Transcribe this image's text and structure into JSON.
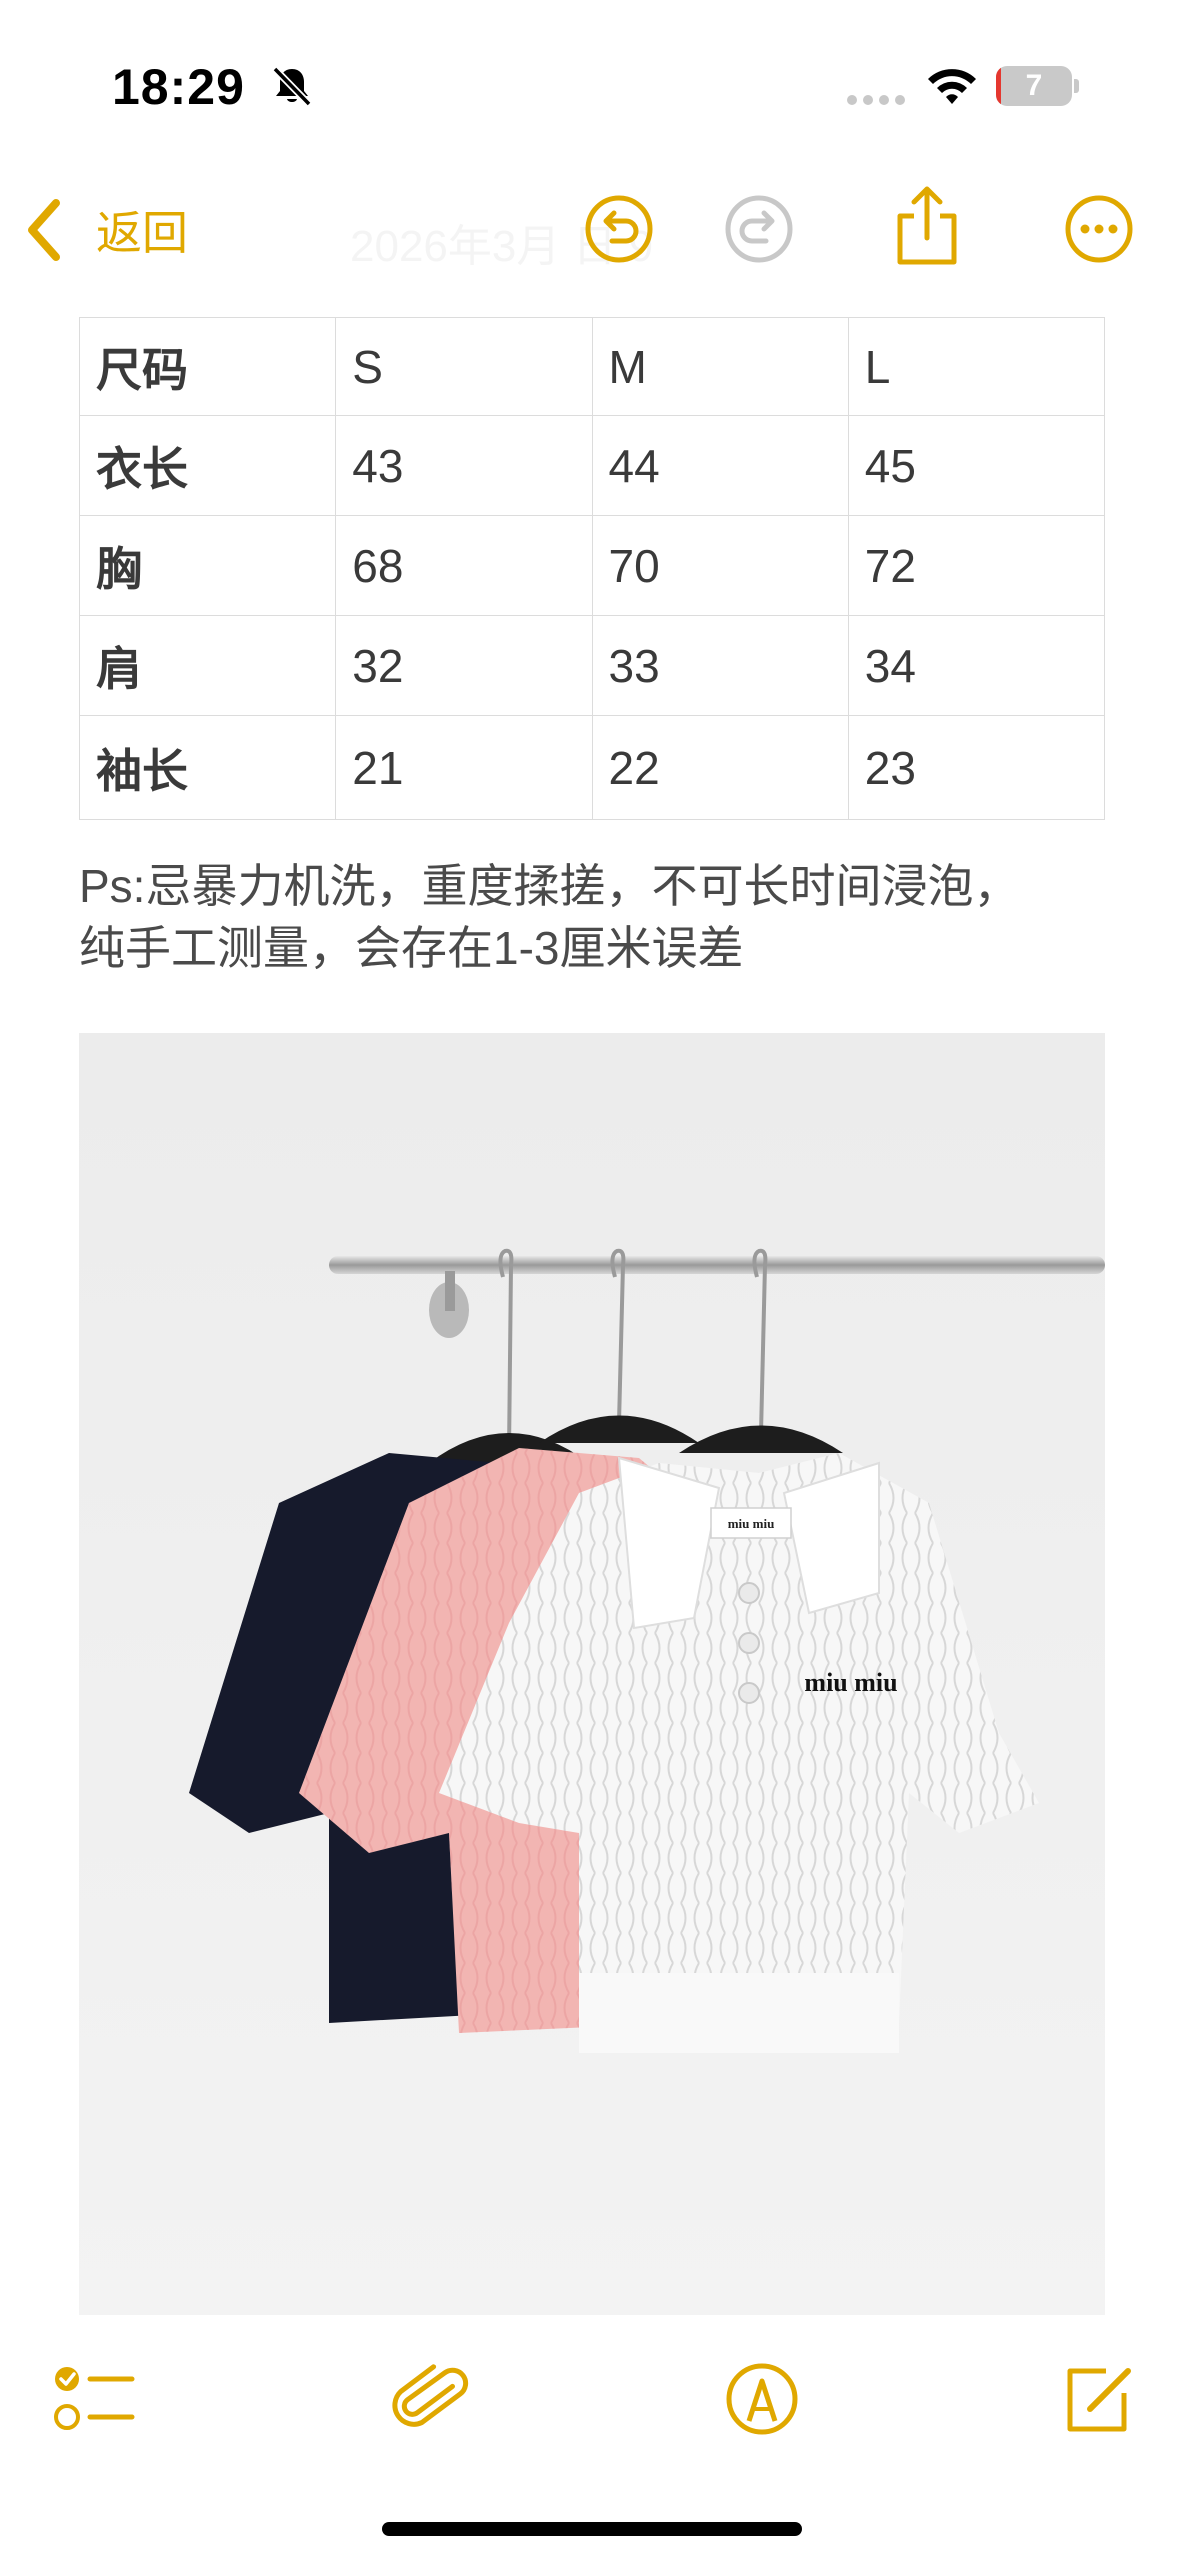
{
  "status_bar": {
    "time": "18:29",
    "battery_level": "7",
    "battery_fraction": 0.07,
    "icons": [
      "bell-slash-icon",
      "cellular-signal-icon",
      "wifi-icon",
      "battery-icon"
    ]
  },
  "nav": {
    "back_label": "返回",
    "date_faded": "2026年3月  日  9",
    "icons": [
      "chevron-left-icon",
      "undo-icon",
      "redo-icon",
      "share-icon",
      "more-icon"
    ]
  },
  "size_table": {
    "rows": [
      [
        "尺码",
        "S",
        "M",
        "L"
      ],
      [
        "衣长",
        "43",
        "44",
        "45"
      ],
      [
        "胸",
        "68",
        "70",
        "72"
      ],
      [
        "肩",
        "32",
        "33",
        "34"
      ],
      [
        "袖长",
        "21",
        "22",
        "23"
      ]
    ]
  },
  "note": {
    "line1": "Ps:忌暴力机洗，重度揉搓，不可长时间浸泡，",
    "line2": "纯手工测量，会存在1-3厘米误差"
  },
  "photo": {
    "brand_text": "miu miu",
    "tag_text": "miu miu"
  },
  "toolbar": {
    "icons": [
      "checklist-icon",
      "paperclip-icon",
      "markup-pen-icon",
      "compose-icon"
    ]
  },
  "colors": {
    "accent": "#e0a800",
    "redo_disabled": "#c8c8c8",
    "battery_low": "#e5372f"
  }
}
